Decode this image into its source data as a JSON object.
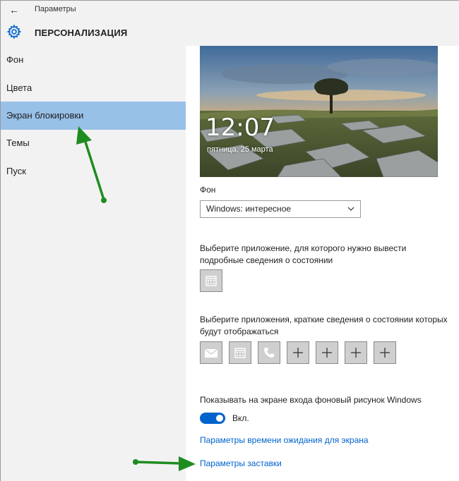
{
  "window": {
    "title": "Параметры",
    "back_icon": "back-arrow-icon"
  },
  "header": {
    "icon": "gear-icon",
    "title": "ПЕРСОНАЛИЗАЦИЯ"
  },
  "sidebar": {
    "items": [
      {
        "label": "Фон",
        "active": false
      },
      {
        "label": "Цвета",
        "active": false
      },
      {
        "label": "Экран блокировки",
        "active": true
      },
      {
        "label": "Темы",
        "active": false
      },
      {
        "label": "Пуск",
        "active": false
      }
    ]
  },
  "lockscreen": {
    "preview": {
      "time": "12:07",
      "date": "пятница, 25 марта"
    },
    "background": {
      "label": "Фон",
      "selected": "Windows: интересное"
    },
    "detailed_status": {
      "label": "Выберите приложение, для которого нужно вывести подробные сведения о состоянии",
      "apps": [
        "calendar-icon"
      ]
    },
    "quick_status": {
      "label": "Выберите приложения, краткие сведения о состоянии которых будут отображаться",
      "apps": [
        "mail-icon",
        "calendar-icon",
        "phone-icon",
        "plus-icon",
        "plus-icon",
        "plus-icon",
        "plus-icon"
      ]
    },
    "signin_background": {
      "label": "Показывать на экране входа фоновый рисунок Windows",
      "state": "Вкл.",
      "on": true
    },
    "links": {
      "screen_timeout": "Параметры времени ожидания для экрана",
      "screensaver": "Параметры заставки"
    }
  },
  "colors": {
    "accent": "#0063cc",
    "active_nav": "#98c1e8",
    "annotation_arrow": "#1e8c1e"
  }
}
